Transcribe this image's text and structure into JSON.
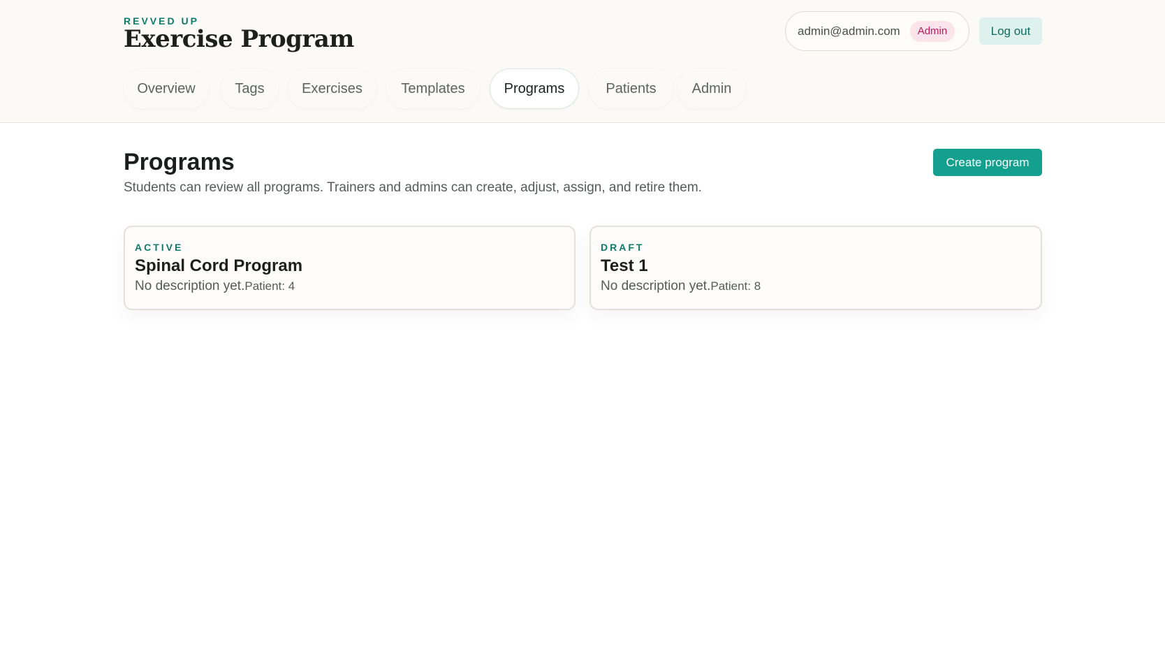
{
  "brand": {
    "kicker": "REVVED UP",
    "title": "Exercise Program"
  },
  "user": {
    "email": "admin@admin.com",
    "role": "Admin",
    "logout_label": "Log out"
  },
  "tabs": [
    {
      "label": "Overview",
      "active": false
    },
    {
      "label": "Tags",
      "active": false
    },
    {
      "label": "Exercises",
      "active": false
    },
    {
      "label": "Templates",
      "active": false
    },
    {
      "label": "Programs",
      "active": true
    },
    {
      "label": "Patients",
      "active": false
    },
    {
      "label": "Admin",
      "active": false
    }
  ],
  "page": {
    "title": "Programs",
    "subtitle": "Students can review all programs. Trainers and admins can create, adjust, assign, and retire them.",
    "create_label": "Create program"
  },
  "programs": [
    {
      "status": "ACTIVE",
      "name": "Spinal Cord Program",
      "description": "No description yet.",
      "patient": "Patient: 4"
    },
    {
      "status": "DRAFT",
      "name": "Test 1",
      "description": "No description yet.",
      "patient": "Patient: 8"
    }
  ],
  "colors": {
    "accent": "#13a08e",
    "accent_text": "#0f7a6c",
    "role_badge_bg": "#fbe4ec",
    "role_badge_text": "#c2185b"
  }
}
